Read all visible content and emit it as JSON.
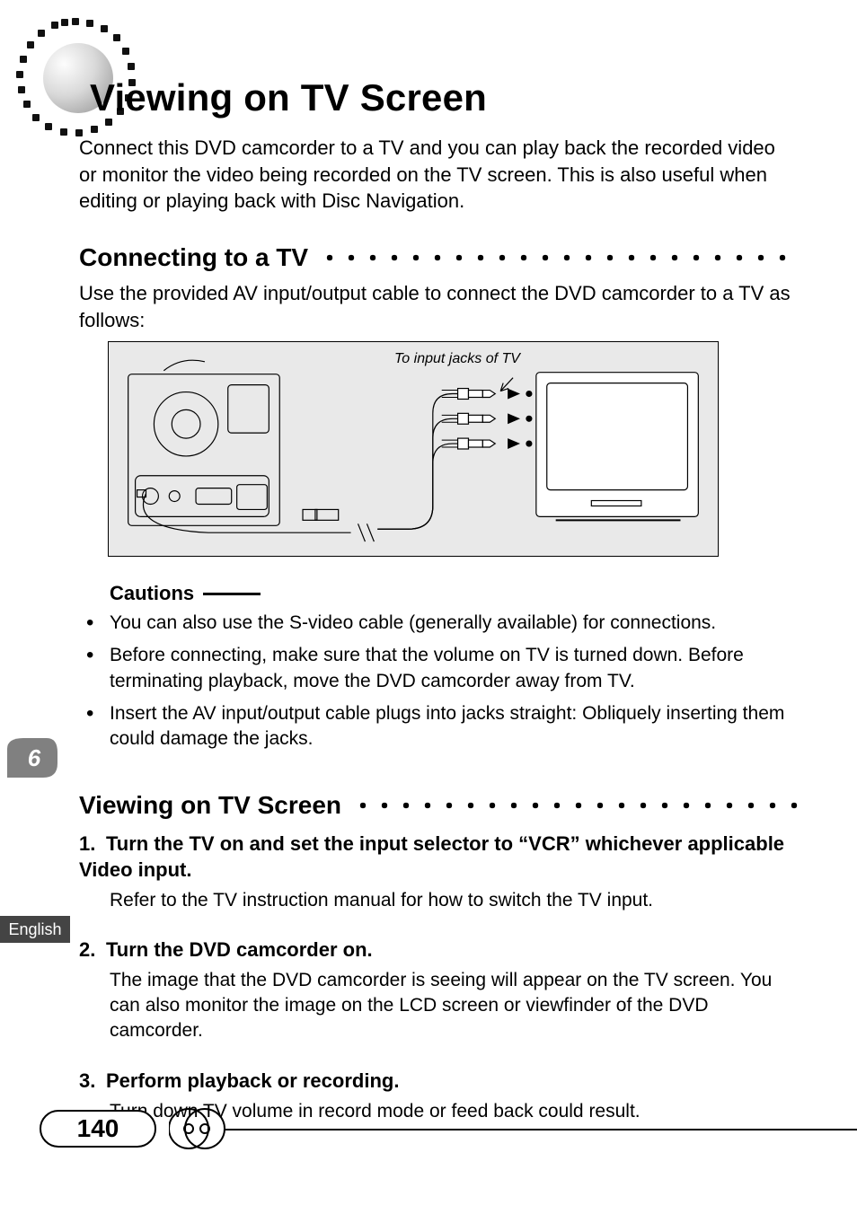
{
  "chapter": {
    "title": "Viewing on TV Screen",
    "intro": "Connect this DVD camcorder to a TV and you can play back the recorded video or monitor the video being recorded on the TV screen. This is also useful when editing or playing back with Disc Navigation."
  },
  "section_connecting": {
    "title": "Connecting to a TV",
    "intro": "Use the provided AV input/output cable to connect the DVD camcorder to a TV as follows:",
    "diagram_caption": "To input jacks of TV"
  },
  "cautions": {
    "title": "Cautions",
    "items": [
      "You can also use the S-video cable (generally available) for connections.",
      "Before connecting, make sure that the volume on TV is turned down. Before terminating playback, move the DVD camcorder away from TV.",
      "Insert the AV input/output cable plugs into jacks straight: Obliquely inserting them could damage the jacks."
    ]
  },
  "section_viewing": {
    "title": "Viewing on TV Screen",
    "steps": [
      {
        "num": "1.",
        "head": "Turn the TV on and set the input selector to “VCR” whichever applicable Video input.",
        "body": "Refer to the TV instruction manual for how to switch the TV input."
      },
      {
        "num": "2.",
        "head": "Turn the DVD camcorder on.",
        "body": "The image that the DVD camcorder is seeing will appear on the TV screen. You can also monitor the image on the LCD screen or viewfinder of the DVD camcorder."
      },
      {
        "num": "3.",
        "head": "Perform playback or recording.",
        "body": "Turn down TV volume in record mode or feed back could result."
      }
    ]
  },
  "side": {
    "chapter_number": "6",
    "language": "English"
  },
  "footer": {
    "page_number": "140"
  }
}
